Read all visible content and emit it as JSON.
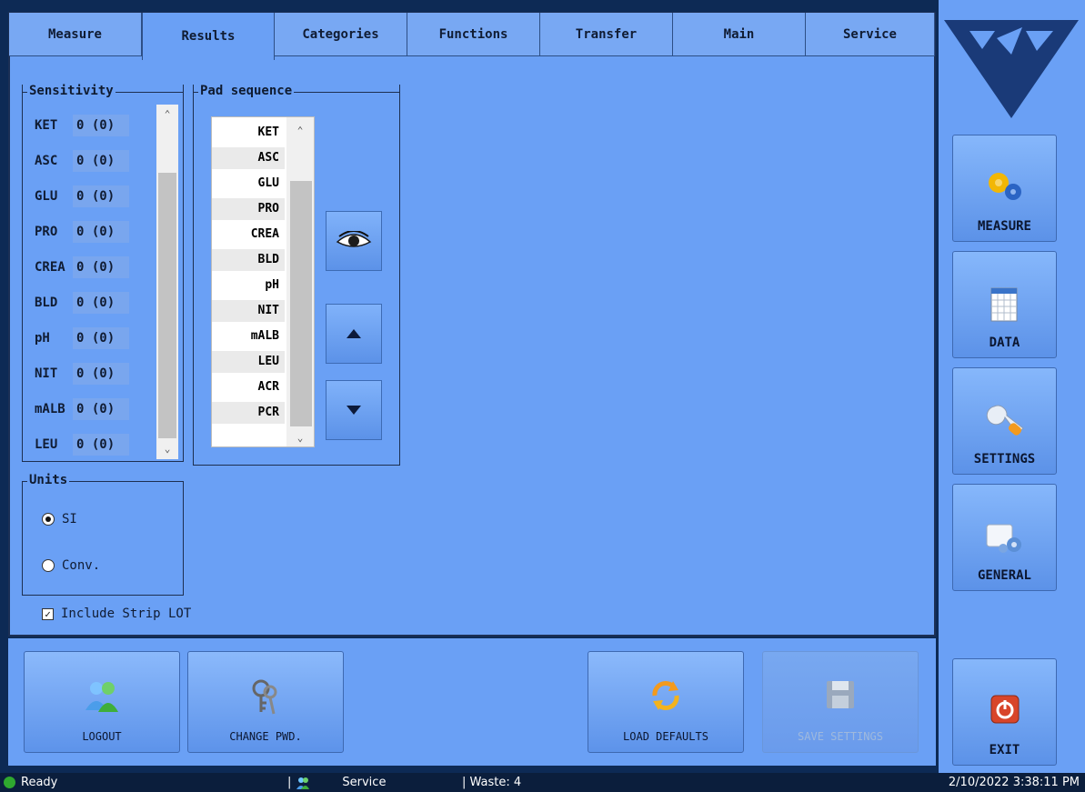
{
  "tabs": [
    {
      "label": "Measure"
    },
    {
      "label": "Results"
    },
    {
      "label": "Categories"
    },
    {
      "label": "Functions"
    },
    {
      "label": "Transfer"
    },
    {
      "label": "Main"
    },
    {
      "label": "Service"
    }
  ],
  "sensitivity": {
    "legend": "Sensitivity",
    "rows": [
      {
        "label": "KET",
        "value": "0 (0)"
      },
      {
        "label": "ASC",
        "value": "0 (0)"
      },
      {
        "label": "GLU",
        "value": "0 (0)"
      },
      {
        "label": "PRO",
        "value": "0 (0)"
      },
      {
        "label": "CREA",
        "value": "0 (0)"
      },
      {
        "label": "BLD",
        "value": "0 (0)"
      },
      {
        "label": "pH",
        "value": "0 (0)"
      },
      {
        "label": "NIT",
        "value": "0 (0)"
      },
      {
        "label": "mALB",
        "value": "0 (0)"
      },
      {
        "label": "LEU",
        "value": "0 (0)"
      }
    ]
  },
  "pad_sequence": {
    "legend": "Pad sequence",
    "items": [
      "KET",
      "ASC",
      "GLU",
      "PRO",
      "CREA",
      "BLD",
      "pH",
      "NIT",
      "mALB",
      "LEU",
      "ACR",
      "PCR"
    ]
  },
  "units": {
    "legend": "Units",
    "options": [
      {
        "label": "SI",
        "checked": true
      },
      {
        "label": "Conv.",
        "checked": false
      }
    ]
  },
  "include_strip_lot": {
    "label": "Include Strip LOT",
    "checked": true
  },
  "bottom_buttons": {
    "logout": "LOGOUT",
    "change_pwd": "CHANGE PWD.",
    "load_defaults": "LOAD DEFAULTS",
    "save_settings": "SAVE SETTINGS"
  },
  "right_nav": {
    "measure": "MEASURE",
    "data": "DATA",
    "settings": "SETTINGS",
    "general": "GENERAL",
    "exit": "EXIT"
  },
  "status_bar": {
    "state": "Ready",
    "user": "Service",
    "waste": "| Waste: 4",
    "datetime": "2/10/2022 3:38:11 PM"
  },
  "colors": {
    "panel": "#6aa0f5",
    "frame": "#0d2a55",
    "status": "#0b1e3c"
  }
}
